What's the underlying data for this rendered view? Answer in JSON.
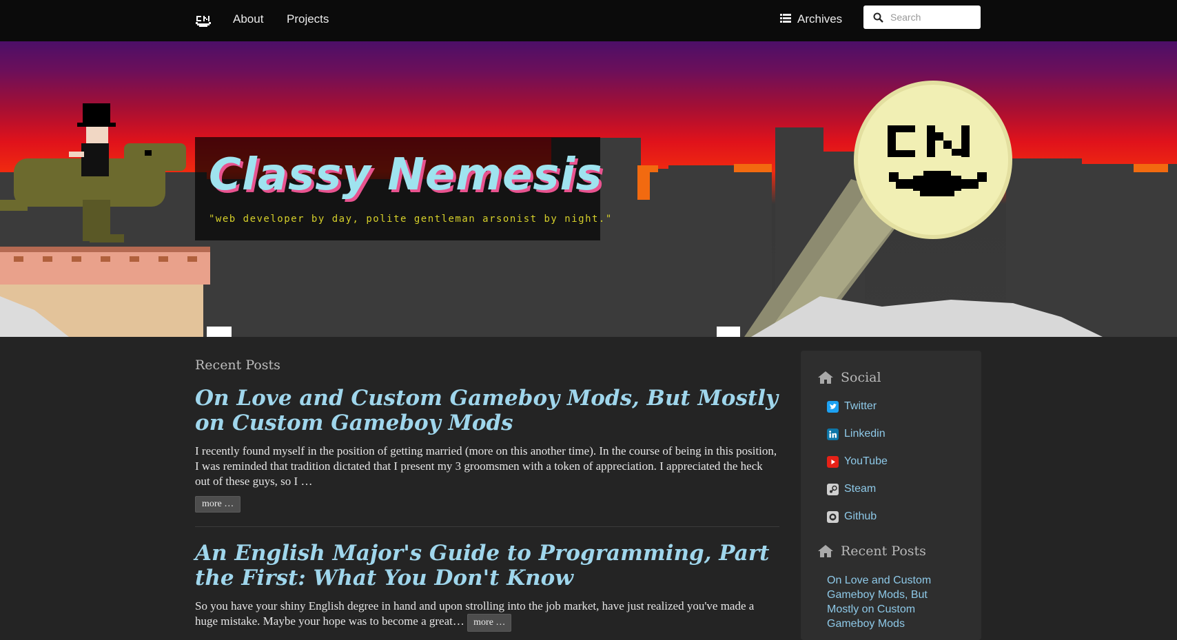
{
  "nav": {
    "brand": "CN",
    "about": "About",
    "projects": "Projects",
    "archives": "Archives",
    "search_placeholder": "Search"
  },
  "hero": {
    "title": "Classy Nemesis",
    "tagline": "\"web developer by day, polite gentleman arsonist by night.\"",
    "moon_text": "CN"
  },
  "main": {
    "heading": "Recent Posts",
    "posts": [
      {
        "title": "On Love and Custom Gameboy Mods, But Mostly on Custom Gameboy Mods",
        "excerpt": "I recently found myself in the position of getting married (more on this another time). In the course of being in this position, I was reminded that tradition dictated that I present my 3 groomsmen with a token of appreciation. I appreciated the heck out of these guys, so I …",
        "more": "more …"
      },
      {
        "title": "An English Major's Guide to Programming, Part the First: What You Don't Know",
        "excerpt": "So you have your shiny English degree in hand and upon strolling into the job market, have just realized you've made a huge mistake. Maybe your hope was to become a great…",
        "more": "more …"
      }
    ]
  },
  "sidebar": {
    "social_heading": "Social",
    "social": [
      {
        "label": "Twitter",
        "icon": "twitter-icon",
        "color": "#1da1f2"
      },
      {
        "label": "Linkedin",
        "icon": "linkedin-icon",
        "color": "#0e76a8"
      },
      {
        "label": "YouTube",
        "icon": "youtube-icon",
        "color": "#e62117"
      },
      {
        "label": "Steam",
        "icon": "steam-icon",
        "color": "#cfcfcf"
      },
      {
        "label": "Github",
        "icon": "github-icon",
        "color": "#cfcfcf"
      }
    ],
    "recent_heading": "Recent Posts",
    "recent": [
      {
        "label": "On Love and Custom Gameboy Mods, But Mostly on Custom Gameboy Mods"
      }
    ]
  },
  "colors": {
    "nav_bg": "#0b0b0b",
    "page_bg": "#242424",
    "link": "#8ec9e8",
    "title_cyan": "#9fe3ef",
    "title_pink": "#e8538f",
    "tagline_yellow": "#d6d02a",
    "moon": "#f1efb4"
  }
}
